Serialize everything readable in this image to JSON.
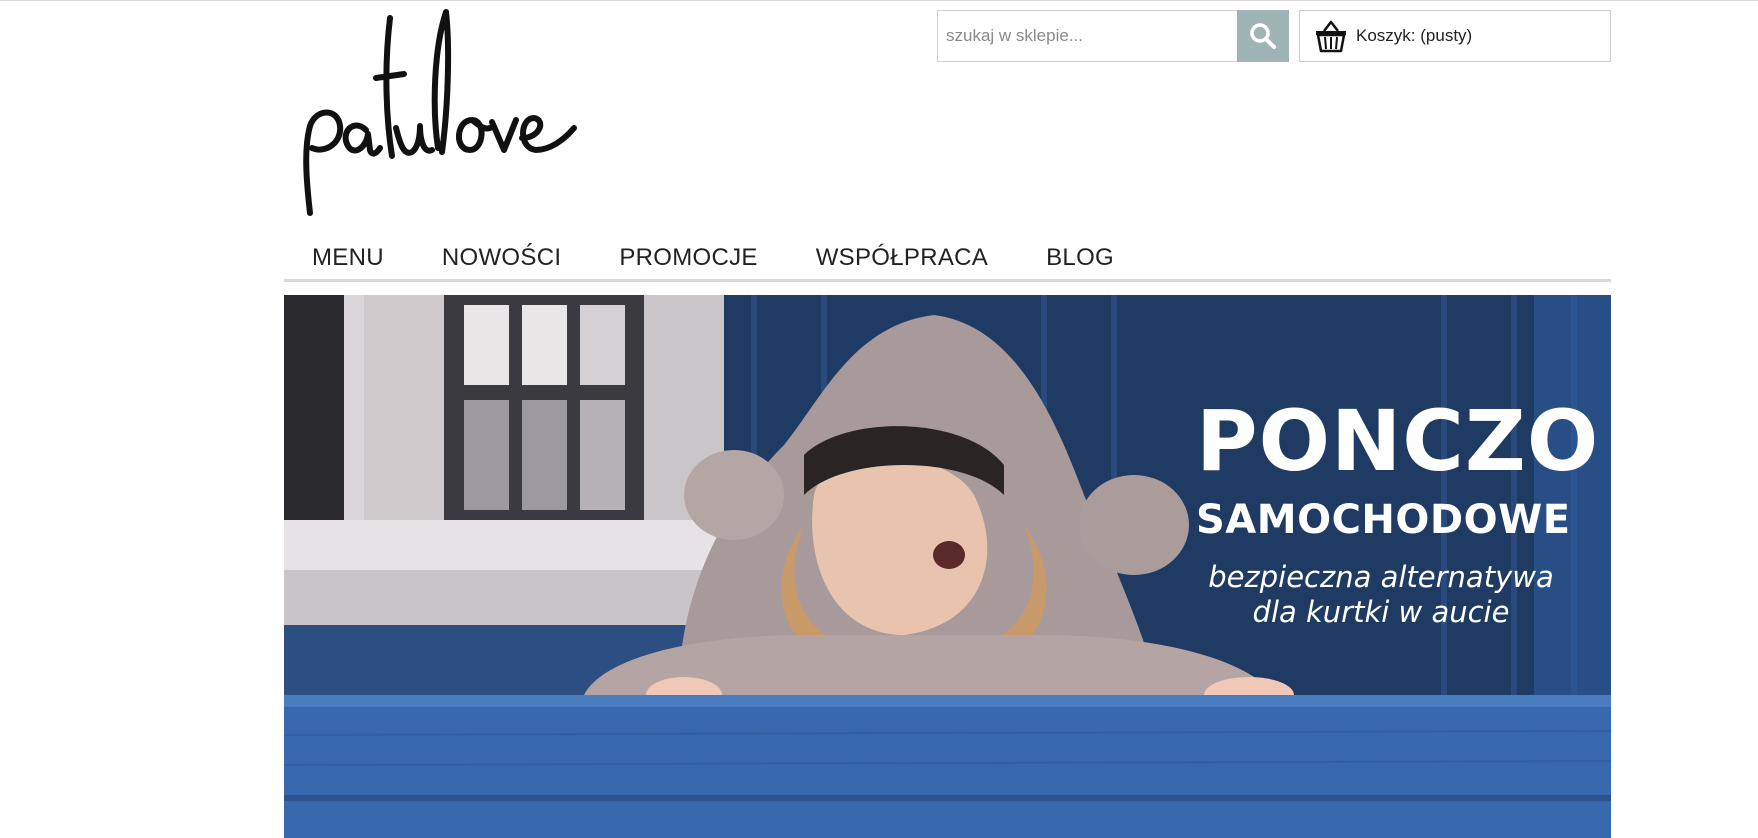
{
  "brand": {
    "logo_text": "patulove"
  },
  "search": {
    "placeholder": "szukaj w sklepie...",
    "value": ""
  },
  "cart": {
    "label": "Koszyk:",
    "status": "(pusty)"
  },
  "nav": {
    "items": [
      {
        "label": "MENU"
      },
      {
        "label": "NOWOŚCI"
      },
      {
        "label": "PROMOCJE"
      },
      {
        "label": "WSPÓŁPRACA"
      },
      {
        "label": "BLOG"
      }
    ]
  },
  "banner": {
    "title": "PONCZO",
    "subtitle": "SAMOCHODOWE",
    "tagline_line1": "bezpieczna alternatywa",
    "tagline_line2": "dla kurtki w aucie"
  },
  "colors": {
    "search_button": "#9fb5b5",
    "banner_blue": "#2a4a78",
    "fence_blue": "#3a6fb5"
  },
  "icons": {
    "search": "search-icon",
    "cart": "basket-icon"
  }
}
